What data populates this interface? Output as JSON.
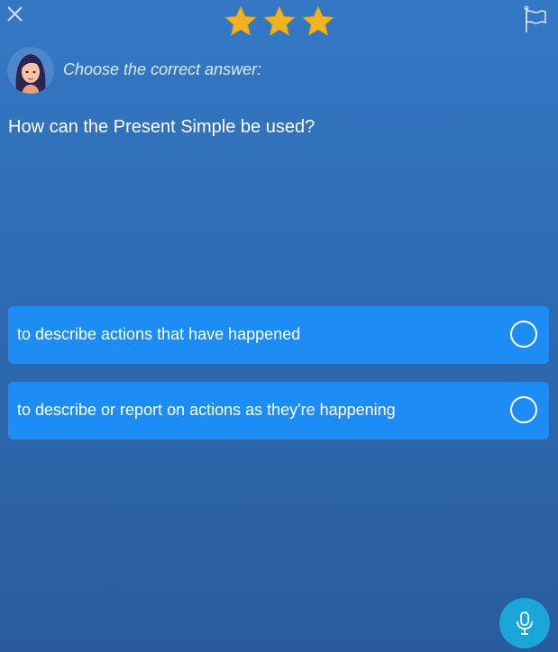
{
  "header": {
    "close_icon": "close-icon",
    "rating": 3,
    "rating_max": 3,
    "flag_icon": "flag-icon",
    "star_color": "#f0b422"
  },
  "prompt": {
    "instruction": "Choose the correct answer:",
    "question": "How can the Present Simple be used?"
  },
  "options": [
    {
      "label": "to describe actions that have happened",
      "selected": false
    },
    {
      "label": "to describe or report on actions as they're happening",
      "selected": false
    }
  ],
  "footer": {
    "mic_icon": "microphone-icon"
  },
  "colors": {
    "background_top": "#3478c5",
    "background_bottom": "#2a5c9c",
    "option_fill": "#1e8cf5",
    "mic_fill": "#1aa6d8"
  }
}
